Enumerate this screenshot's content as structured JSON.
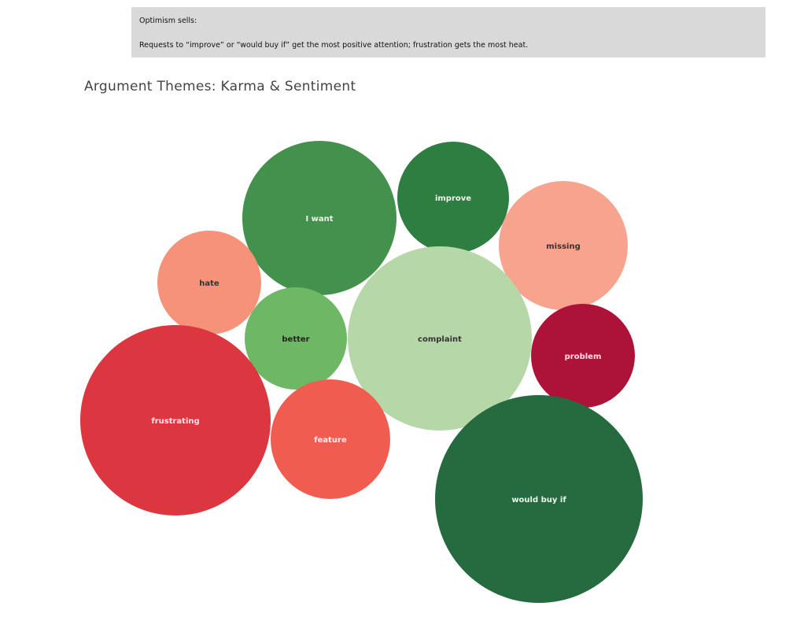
{
  "annotation": {
    "heading": "Optimism sells:",
    "body": "Requests to “improve” or “would buy if” get the most positive attention; frustration gets the most heat."
  },
  "chart_data": {
    "type": "bubble",
    "title": "Argument Themes: Karma & Sentiment",
    "bubbles": [
      {
        "label": "I want",
        "color": "#44914d",
        "text_color": "#eef5ee"
      },
      {
        "label": "improve",
        "color": "#2e7d41",
        "text_color": "#eef5ee"
      },
      {
        "label": "missing",
        "color": "#f8a38e",
        "text_color": "#333333"
      },
      {
        "label": "hate",
        "color": "#f69279",
        "text_color": "#333333"
      },
      {
        "label": "better",
        "color": "#6eb865",
        "text_color": "#222222"
      },
      {
        "label": "complaint",
        "color": "#b6d8a8",
        "text_color": "#333333"
      },
      {
        "label": "problem",
        "color": "#ad1339",
        "text_color": "#ffe3e8"
      },
      {
        "label": "frustrating",
        "color": "#dc3741",
        "text_color": "#ffe8e8"
      },
      {
        "label": "feature",
        "color": "#f05c4f",
        "text_color": "#fff1ee"
      },
      {
        "label": "would buy if",
        "color": "#266a3f",
        "text_color": "#eef5ee"
      }
    ]
  }
}
